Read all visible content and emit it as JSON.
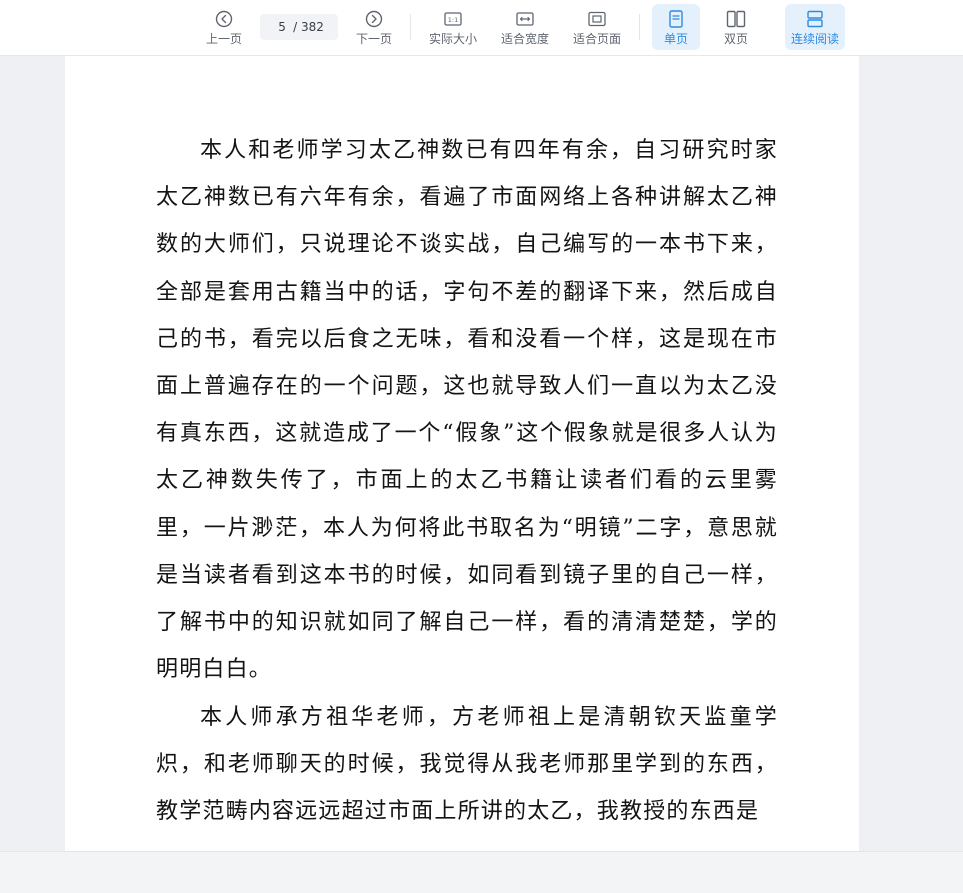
{
  "toolbar": {
    "prev_label": "上一页",
    "next_label": "下一页",
    "current_page": "5",
    "page_total": "/ 382",
    "actual_size_label": "实际大小",
    "fit_width_label": "适合宽度",
    "fit_page_label": "适合页面",
    "single_page_label": "单页",
    "double_page_label": "双页",
    "continuous_label": "连续阅读",
    "actual_size_icon_text": "1:1",
    "accent_color": "#2f8ae0"
  },
  "document": {
    "paragraphs": [
      "本人和老师学习太乙神数已有四年有余，自习研究时家太乙神数已有六年有余，看遍了市面网络上各种讲解太乙神数的大师们，只说理论不谈实战，自己编写的一本书下来，全部是套用古籍当中的话，字句不差的翻译下来，然后成自己的书，看完以后食之无味，看和没看一个样，这是现在市面上普遍存在的一个问题，这也就导致人们一直以为太乙没有真东西，这就造成了一个“假象”这个假象就是很多人认为太乙神数失传了，市面上的太乙书籍让读者们看的云里雾里，一片渺茫，本人为何将此书取名为“明镜”二字，意思就是当读者看到这本书的时候，如同看到镜子里的自己一样，了解书中的知识就如同了解自己一样，看的清清楚楚，学的明明白白。",
      "本人师承方祖华老师，方老师祖上是清朝钦天监童学炽，和老师聊天的时候，我觉得从我老师那里学到的东西，教学范畴内容远远超过市面上所讲的太乙，我教授的东西是"
    ]
  }
}
